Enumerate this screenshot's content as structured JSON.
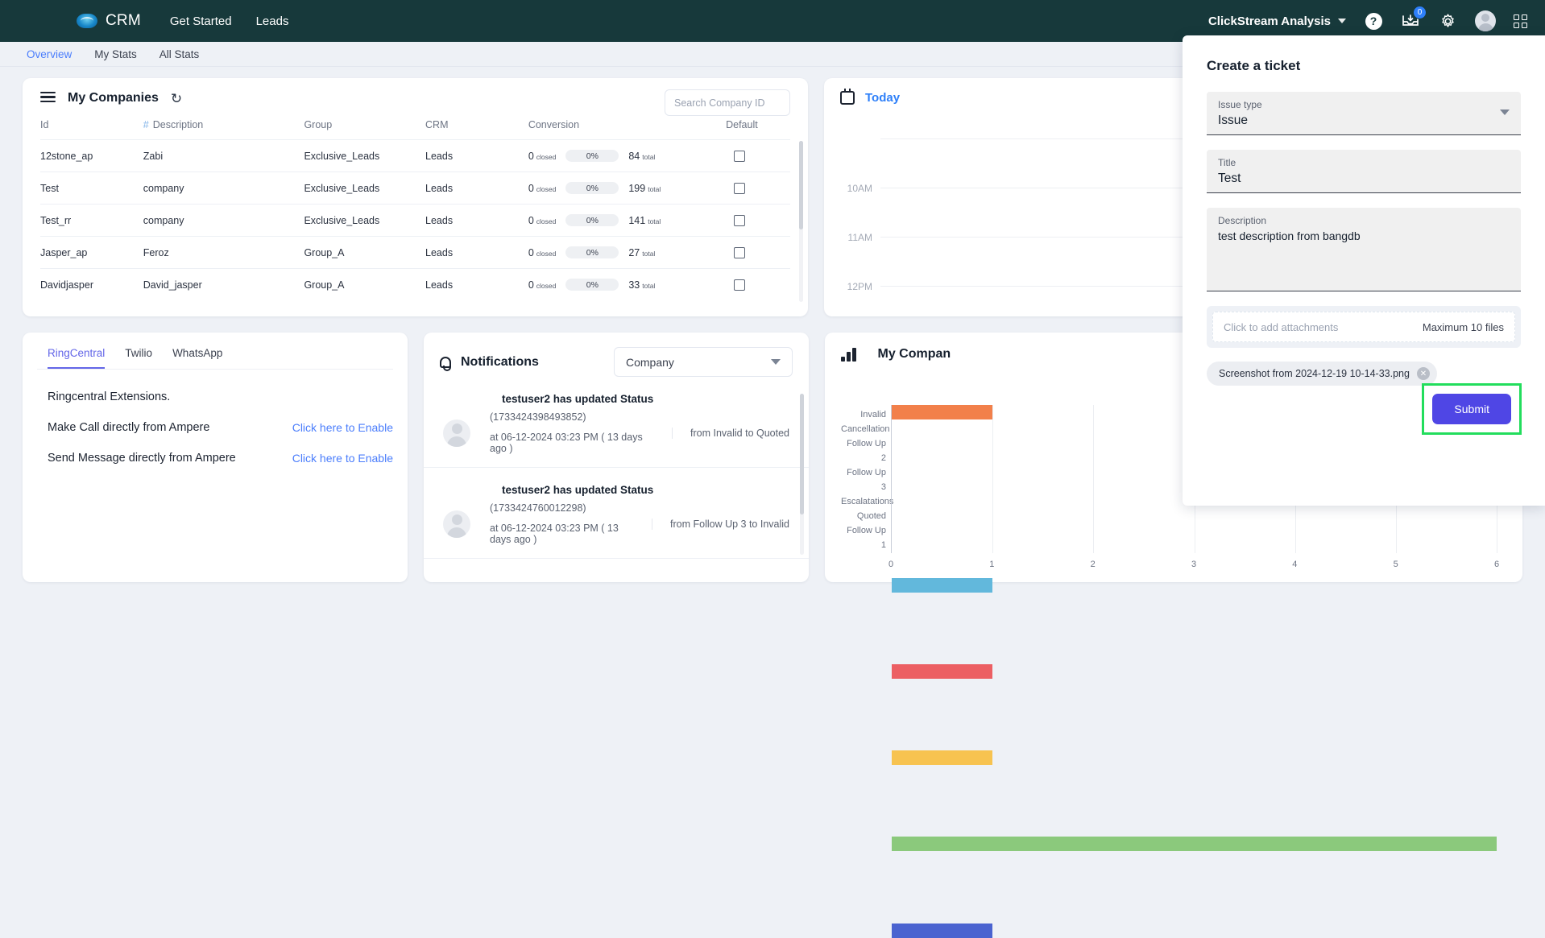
{
  "topnav": {
    "brand": "CRM",
    "links": [
      "Get Started",
      "Leads"
    ],
    "workspace": "ClickStream Analysis",
    "help_icon": "?",
    "inbox_badge": "0"
  },
  "subnav": {
    "items": [
      "Overview",
      "My Stats",
      "All Stats"
    ],
    "active": "Overview"
  },
  "companies": {
    "title": "My Companies",
    "search_placeholder": "Search Company ID",
    "columns": [
      "Id",
      "Description",
      "Group",
      "CRM",
      "Conversion",
      "Default"
    ],
    "rows": [
      {
        "id": "12stone_ap",
        "description": "Zabi",
        "group": "Exclusive_Leads",
        "crm": "Leads",
        "closed": "0",
        "closed_label": "closed",
        "percent": "0%",
        "total": "84",
        "total_label": "total"
      },
      {
        "id": "Test",
        "description": "company",
        "group": "Exclusive_Leads",
        "crm": "Leads",
        "closed": "0",
        "closed_label": "closed",
        "percent": "0%",
        "total": "199",
        "total_label": "total"
      },
      {
        "id": "Test_rr",
        "description": "company",
        "group": "Exclusive_Leads",
        "crm": "Leads",
        "closed": "0",
        "closed_label": "closed",
        "percent": "0%",
        "total": "141",
        "total_label": "total"
      },
      {
        "id": "Jasper_ap",
        "description": "Feroz",
        "group": "Group_A",
        "crm": "Leads",
        "closed": "0",
        "closed_label": "closed",
        "percent": "0%",
        "total": "27",
        "total_label": "total"
      },
      {
        "id": "Davidjasper",
        "description": "David_jasper",
        "group": "Group_A",
        "crm": "Leads",
        "closed": "0",
        "closed_label": "closed",
        "percent": "0%",
        "total": "33",
        "total_label": "total"
      }
    ]
  },
  "today": {
    "label": "Today",
    "times": [
      "10AM",
      "11AM",
      "12PM"
    ]
  },
  "channels": {
    "tabs": [
      "RingCentral",
      "Twilio",
      "WhatsApp"
    ],
    "active_tab": "RingCentral",
    "heading": "Ringcentral Extensions.",
    "rows": [
      {
        "label": "Make Call directly from Ampere",
        "action": "Click here to Enable"
      },
      {
        "label": "Send Message directly from Ampere",
        "action": "Click here to Enable"
      }
    ]
  },
  "notifications": {
    "title": "Notifications",
    "filter": "Company",
    "items": [
      {
        "heading": "testuser2 has updated Status",
        "id": "(1733424398493852)",
        "time": "at 06-12-2024 03:23 PM ( 13 days ago )",
        "from": "from Invalid to Quoted"
      },
      {
        "heading": "testuser2 has updated Status",
        "id": "(1733424760012298)",
        "time": "at 06-12-2024 03:23 PM ( 13 days ago )",
        "from": "from Follow Up 3 to Invalid"
      }
    ]
  },
  "chart_card": {
    "title": "My Compan"
  },
  "chart_data": {
    "type": "bar",
    "orientation": "horizontal",
    "title": "My Compan",
    "categories": [
      "Invalid",
      "Cancellation",
      "Follow Up 2",
      "Follow Up 3",
      "Escalatations",
      "Quoted",
      "Follow Up 1"
    ],
    "values": [
      1,
      0,
      1,
      1,
      1,
      6,
      1
    ],
    "colors": [
      "#f2804a",
      "#f2804a",
      "#62b8dc",
      "#ec5f63",
      "#f7c350",
      "#8bc97c",
      "#4a63d0"
    ],
    "xlabel": "",
    "ylabel": "",
    "xticks": [
      "0",
      "1",
      "2",
      "3",
      "4",
      "5",
      "6"
    ],
    "xlim": [
      0,
      6
    ],
    "grid": true,
    "legend": false
  },
  "ticket": {
    "title": "Create a ticket",
    "issue_type_label": "Issue type",
    "issue_type_value": "Issue",
    "title_label": "Title",
    "title_value": "Test",
    "description_label": "Description",
    "description_value": "test description from bangdb",
    "attach_placeholder": "Click to add attachments",
    "attach_max": "Maximum 10 files",
    "attachment_name": "Screenshot from 2024-12-19 10-14-33.png",
    "submit_label": "Submit",
    "highlight_color": "#22dd5c"
  }
}
